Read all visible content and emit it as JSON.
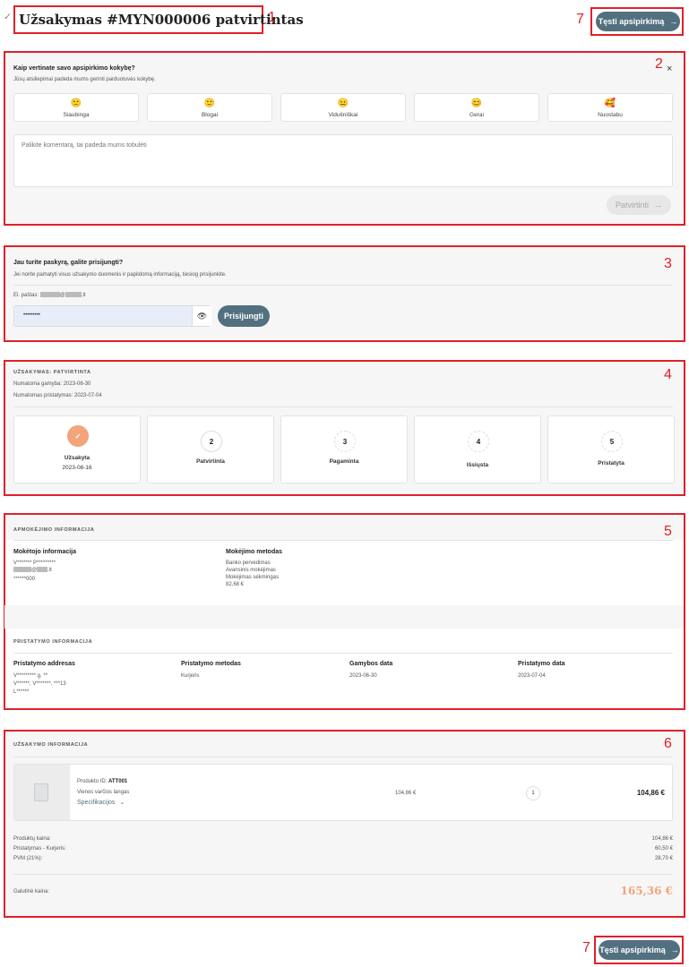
{
  "header": {
    "title": "Užsakymas #MYN000006 patvirtintas",
    "continue_label": "Tęsti apsipirkimą",
    "annotation_title": "1",
    "annotation_continue": "7"
  },
  "feedback": {
    "annotation": "2",
    "question": "Kaip vertinate savo apsipirkimo kokybę?",
    "subtitle": "Jūsų atsiliepimai padeda mums gerinti parduotuvės kokybę.",
    "ratings": [
      {
        "label": "Siaubinga",
        "emoji": "🙁"
      },
      {
        "label": "Blogai",
        "emoji": "🙂"
      },
      {
        "label": "Vidutiniškai",
        "emoji": "😐"
      },
      {
        "label": "Gerai",
        "emoji": "😊"
      },
      {
        "label": "Nuostabu",
        "emoji": "🥰"
      }
    ],
    "comment_placeholder": "Palikite komentarą, tai padeda mums tobulėti",
    "submit_label": "Patvirtinti"
  },
  "login": {
    "annotation": "3",
    "title": "Jau turite paskyrą, galite prisijungti?",
    "subtitle": "Jei norite pamatyti visus užsakymo duomenis ir papildomą informaciją, tiesiog prisijunkite.",
    "email_label": "El. paštas:",
    "email_at": "@",
    "email_tld": ".lt",
    "password_value": "•••••••••",
    "login_label": "Prisijungti"
  },
  "status": {
    "annotation": "4",
    "heading": "UŽSAKYMAS: PATVIRTINTA",
    "production_line": "Numatoma gamyba: 2023-06-30",
    "delivery_line": "Numatomas pristatymas: 2023-07-04",
    "steps": [
      {
        "num": "✓",
        "label": "Užsakyta",
        "date": "2023-06-16",
        "done": true
      },
      {
        "num": "2",
        "label": "Patvirtinta",
        "date": ""
      },
      {
        "num": "3",
        "label": "Pagaminta",
        "date": ""
      },
      {
        "num": "4",
        "label": "Išsiųsta",
        "date": ""
      },
      {
        "num": "5",
        "label": "Pristatyta",
        "date": ""
      }
    ]
  },
  "payment": {
    "annotation": "5",
    "heading": "APMOKĖJIMO INFORMACIJA",
    "payer_title": "Mokėtojo informacija",
    "payer_name": "V******* P*********",
    "payer_email_at": "@",
    "payer_email_tld": ".lt",
    "payer_phone": "******000",
    "method_title": "Mokėjimo metodas",
    "method_lines": [
      "Banko pervedimas",
      "Avansinis mokėjimas",
      "Mokėjimas sėkmingas",
      "82,68 €"
    ]
  },
  "delivery": {
    "heading": "PRISTATYMO INFORMACIJA",
    "address_title": "Pristatymo addresas",
    "address_lines": [
      "V********* g. **",
      "V******, V*******, ***13",
      "L******"
    ],
    "method_title": "Pristatymo metodas",
    "method_value": "Kurjeris",
    "production_title": "Gamybos data",
    "production_value": "2023-06-30",
    "delivery_title": "Pristatymo data",
    "delivery_value": "2023-07-04"
  },
  "order": {
    "annotation": "6",
    "heading": "UŽSAKYMO INFORMACIJA",
    "product_id_label": "Produkto ID:",
    "product_id": "ATT001",
    "product_name": "Vienos varčios langas",
    "spec_label": "Specifikacijos",
    "unit_price": "104,86 €",
    "quantity": "1",
    "line_total": "104,86 €",
    "summary": [
      {
        "label": "Produktų kaina:",
        "value": "104,86 €"
      },
      {
        "label": "Pristatymas - Kurjeris:",
        "value": "60,50 €"
      },
      {
        "label": "PVM (21%):",
        "value": "28,70 €"
      }
    ],
    "final_label": "Galutinė kaina:",
    "final_value": "165,36 €"
  },
  "footer": {
    "continue_label": "Tęsti apsipirkimą",
    "annotation": "7"
  },
  "colors": {
    "accent": "#52707f",
    "annotation": "#e0202a",
    "success": "#f3a47a"
  }
}
